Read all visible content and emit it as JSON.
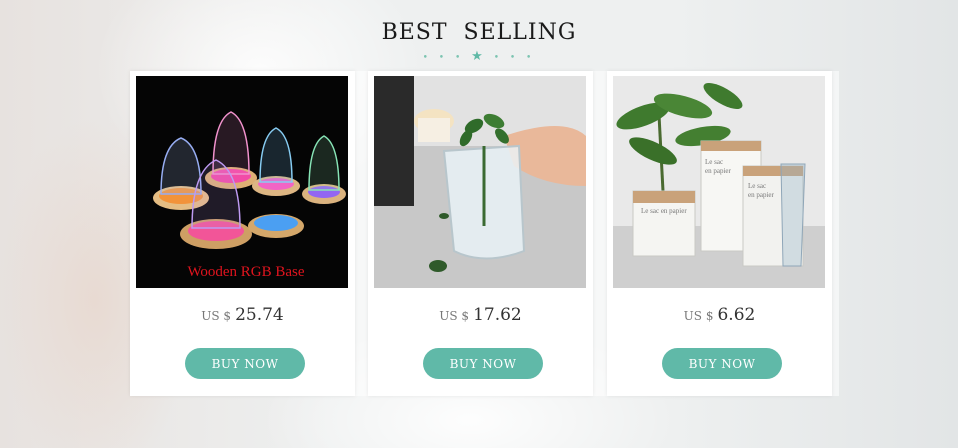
{
  "section": {
    "title": "BEST  SELLING",
    "deco": "• • • ★ • • •"
  },
  "products": [
    {
      "image_caption": "Wooden RGB Base",
      "currency": "US $",
      "price": "25.74",
      "button": "BUY NOW"
    },
    {
      "currency": "US $",
      "price": "17.62",
      "button": "BUY NOW"
    },
    {
      "currency": "US $",
      "price": "6.62",
      "button": "BUY NOW"
    }
  ],
  "colors": {
    "accent": "#60b9a8",
    "deco": "#7cc4b1"
  }
}
